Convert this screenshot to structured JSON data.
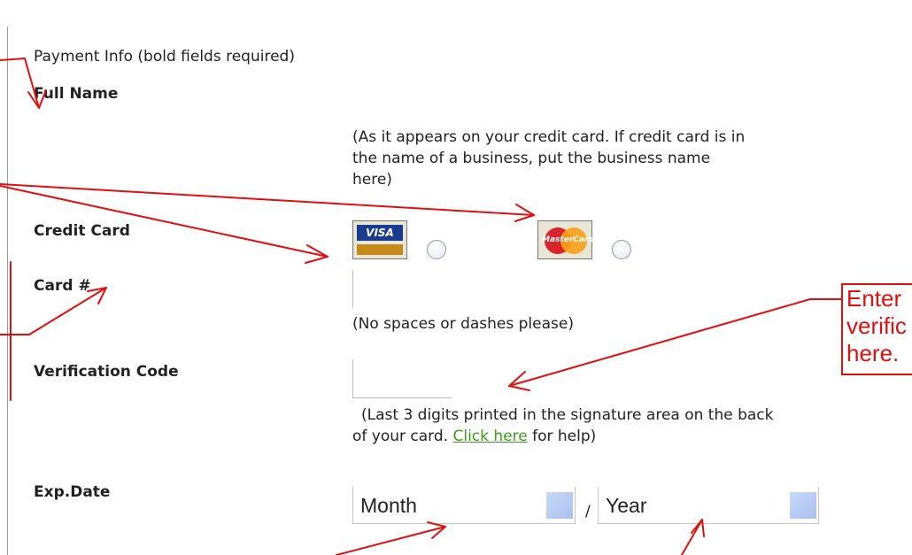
{
  "section": {
    "title": "Payment Info (bold fields required)"
  },
  "full_name": {
    "label": "Full Name",
    "hint": [
      "(As it appears on your credit card. If credit card is in",
      "the name of a business, put the business name",
      "here)"
    ]
  },
  "credit_card": {
    "label": "Credit Card",
    "visa_text": "VISA",
    "mastercard_text": "MasterCard"
  },
  "card_number": {
    "label": "Card #",
    "hint": "(No spaces or dashes please)"
  },
  "verification": {
    "label": "Verification Code",
    "hint_line1": "(Last 3 digits printed in the signature area on the back",
    "hint_pre": "of your card. ",
    "link": "Click here",
    "hint_post": " for help)"
  },
  "exp_date": {
    "label": "Exp.Date",
    "month": "Month",
    "separator": "/",
    "year": "Year"
  },
  "annotation": {
    "lines": [
      "Enter",
      "verific",
      "here."
    ],
    "color": "#e01010"
  },
  "colors": {
    "link": "#3c9a1e",
    "annotation": "#e01010"
  }
}
